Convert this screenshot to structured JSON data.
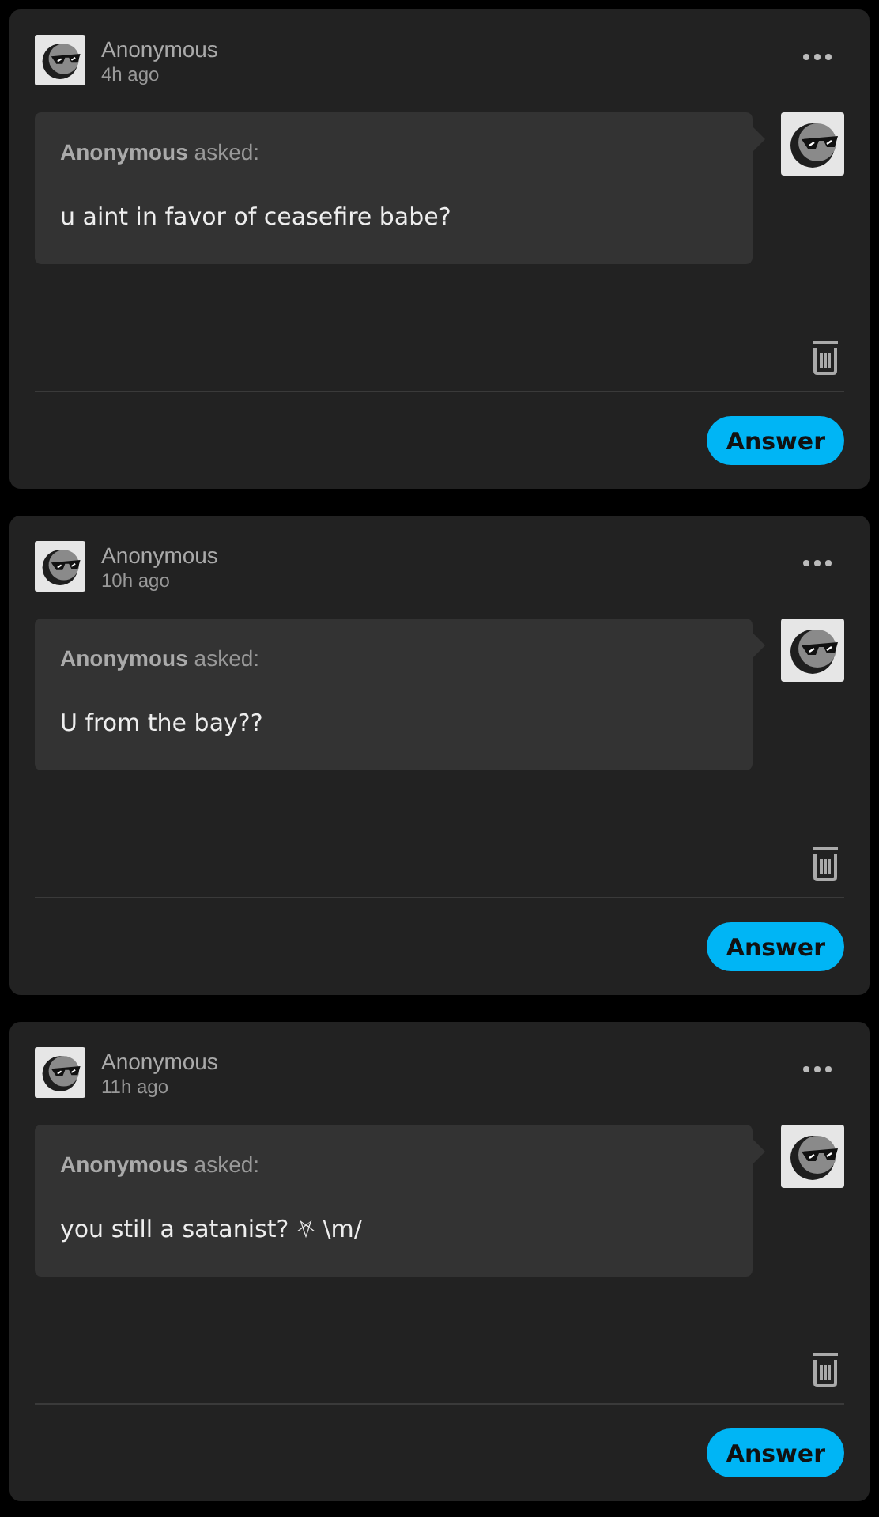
{
  "asks": [
    {
      "author": "Anonymous",
      "time": "4h ago",
      "asker": "Anonymous",
      "asked_label": "asked:",
      "question": "u aint in favor of ceasefire babe?",
      "button": "Answer"
    },
    {
      "author": "Anonymous",
      "time": "10h ago",
      "asker": "Anonymous",
      "asked_label": "asked:",
      "question": "U from the bay??",
      "button": "Answer"
    },
    {
      "author": "Anonymous",
      "time": "11h ago",
      "asker": "Anonymous",
      "asked_label": "asked:",
      "question": "you still a satanist? ⛧ \\m/",
      "button": "Answer"
    }
  ]
}
